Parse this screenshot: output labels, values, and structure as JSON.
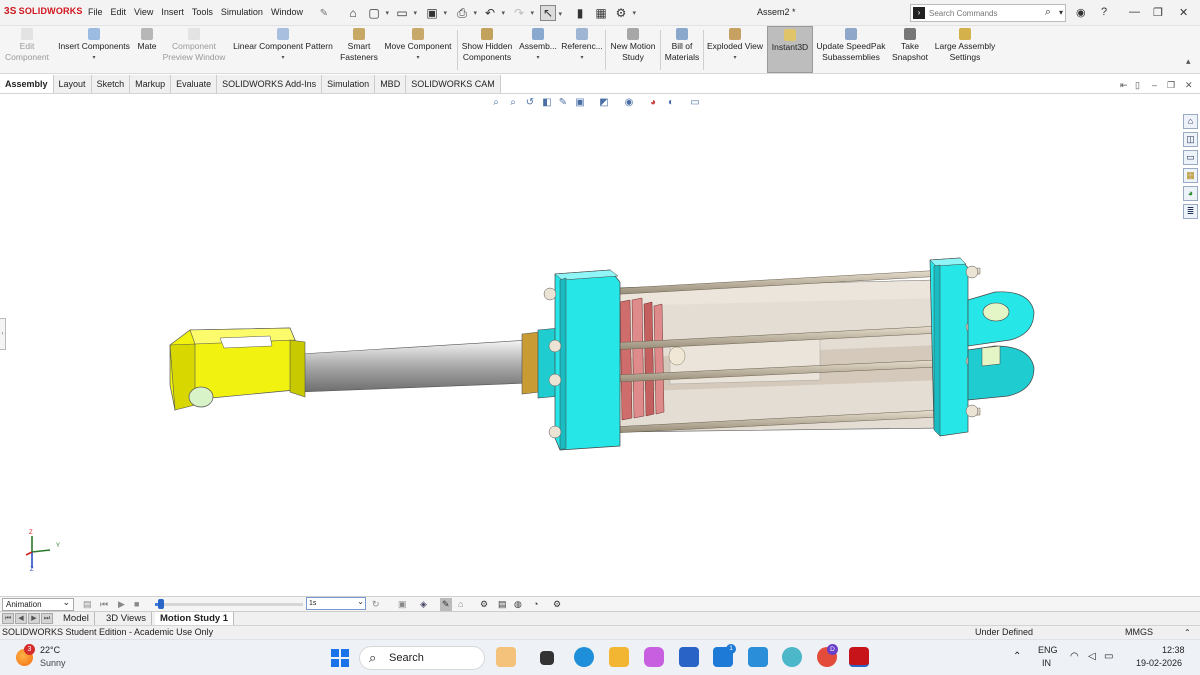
{
  "app": {
    "brand": "SOLIDWORKS",
    "document_title": "Assem2 *",
    "menus": [
      "File",
      "Edit",
      "View",
      "Insert",
      "Tools",
      "Simulation",
      "Window"
    ]
  },
  "search": {
    "placeholder": "Search Commands"
  },
  "commands": [
    {
      "line1": "Edit",
      "line2": "Component",
      "disabled": true
    },
    {
      "line1": "Insert Components",
      "line2": "",
      "disabled": false
    },
    {
      "line1": "Mate",
      "line2": "",
      "disabled": false
    },
    {
      "line1": "Component",
      "line2": "Preview Window",
      "disabled": true
    },
    {
      "line1": "Linear Component Pattern",
      "line2": "",
      "disabled": false
    },
    {
      "line1": "Smart",
      "line2": "Fasteners",
      "disabled": false
    },
    {
      "line1": "Move Component",
      "line2": "",
      "disabled": false
    },
    {
      "line1": "Show Hidden",
      "line2": "Components",
      "disabled": false
    },
    {
      "line1": "Assemb...",
      "line2": "",
      "disabled": false
    },
    {
      "line1": "Referenc...",
      "line2": "",
      "disabled": false
    },
    {
      "line1": "New Motion",
      "line2": "Study",
      "disabled": false
    },
    {
      "line1": "Bill of",
      "line2": "Materials",
      "disabled": false
    },
    {
      "line1": "Exploded View",
      "line2": "",
      "disabled": false
    },
    {
      "line1": "Instant3D",
      "line2": "",
      "disabled": false,
      "active": true
    },
    {
      "line1": "Update SpeedPak",
      "line2": "Subassemblies",
      "disabled": false
    },
    {
      "line1": "Take",
      "line2": "Snapshot",
      "disabled": false
    },
    {
      "line1": "Large Assembly",
      "line2": "Settings",
      "disabled": false
    }
  ],
  "tabs": [
    "Assembly",
    "Layout",
    "Sketch",
    "Markup",
    "Evaluate",
    "SOLIDWORKS Add-Ins",
    "Simulation",
    "MBD",
    "SOLIDWORKS CAM"
  ],
  "active_tab": "Assembly",
  "triad": {
    "z": "Z",
    "y": "Y",
    "z2": "Z"
  },
  "motion": {
    "study_type": "Animation",
    "time_value": "1s",
    "slider_fraction": 0.02
  },
  "bottom_tabs": [
    "Model",
    "3D Views",
    "Motion Study 1"
  ],
  "active_bottom_tab": "Motion Study 1",
  "status": {
    "left": "SOLIDWORKS Student Edition - Academic Use Only",
    "state": "Under Defined",
    "units": "MMGS"
  },
  "taskbar": {
    "temperature": "22°C",
    "condition": "Sunny",
    "weather_badge": "3",
    "search": "Search",
    "language": "ENG",
    "region": "IN",
    "time": "12:38",
    "date": "19-02-2026",
    "todo_badge": "1",
    "avatar_letter": "D"
  },
  "colors": {
    "yellow_part": "#f2f211",
    "cyan_part": "#27e6e8",
    "cylinder_glass": "#d9cfc3",
    "piston_red": "#d97878",
    "brand_red": "#d0161e"
  }
}
